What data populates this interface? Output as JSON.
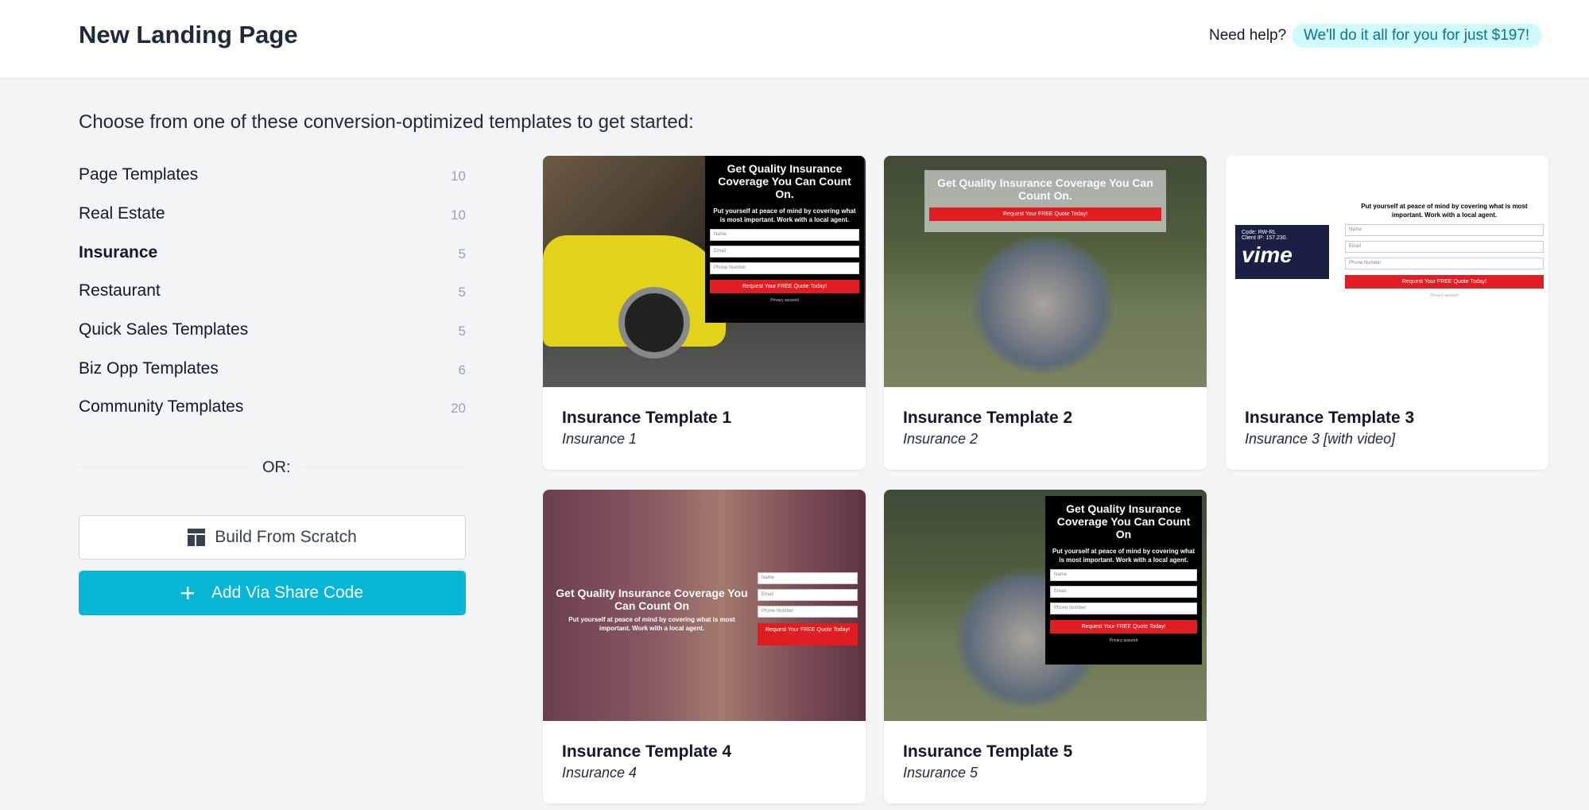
{
  "header": {
    "title": "New Landing Page",
    "help_text": "Need help?",
    "help_offer": "We'll do it all for you for just $197!"
  },
  "intro": "Choose from one of these conversion-optimized templates to get started:",
  "categories": [
    {
      "label": "Page Templates",
      "count": "10"
    },
    {
      "label": "Real Estate",
      "count": "10"
    },
    {
      "label": "Insurance",
      "count": "5"
    },
    {
      "label": "Restaurant",
      "count": "5"
    },
    {
      "label": "Quick Sales Templates",
      "count": "5"
    },
    {
      "label": "Biz Opp Templates",
      "count": "6"
    },
    {
      "label": "Community Templates",
      "count": "20"
    }
  ],
  "active_category": "Insurance",
  "or_label": "OR:",
  "buttons": {
    "scratch": "Build From Scratch",
    "share": "Add Via Share Code"
  },
  "thumb": {
    "headline": "Get Quality Insurance Coverage You Can Count On.",
    "headline_short": "Get Quality Insurance Coverage You Can Count On",
    "subtext": "Put yourself at peace of mind by covering what is most important. Work with a local agent.",
    "name_ph": "Name",
    "email_ph": "Email",
    "phone_ph": "Phone Number",
    "cta": "Request Your FREE Quote Today!",
    "privacy": "Privacy assured",
    "video_code": "Code: RW-RL",
    "video_ip": "Client IP: 157.230.",
    "video_logo": "vime"
  },
  "templates": [
    {
      "title": "Insurance Template 1",
      "subtitle": "Insurance 1"
    },
    {
      "title": "Insurance Template 2",
      "subtitle": "Insurance 2"
    },
    {
      "title": "Insurance Template 3",
      "subtitle": "Insurance 3 [with video]"
    },
    {
      "title": "Insurance Template 4",
      "subtitle": "Insurance 4"
    },
    {
      "title": "Insurance Template 5",
      "subtitle": "Insurance 5"
    }
  ],
  "colors": {
    "accent": "#06b6d4",
    "pill_bg": "#cffafe",
    "pill_text": "#0e7490",
    "cta_red": "#e11d24"
  }
}
